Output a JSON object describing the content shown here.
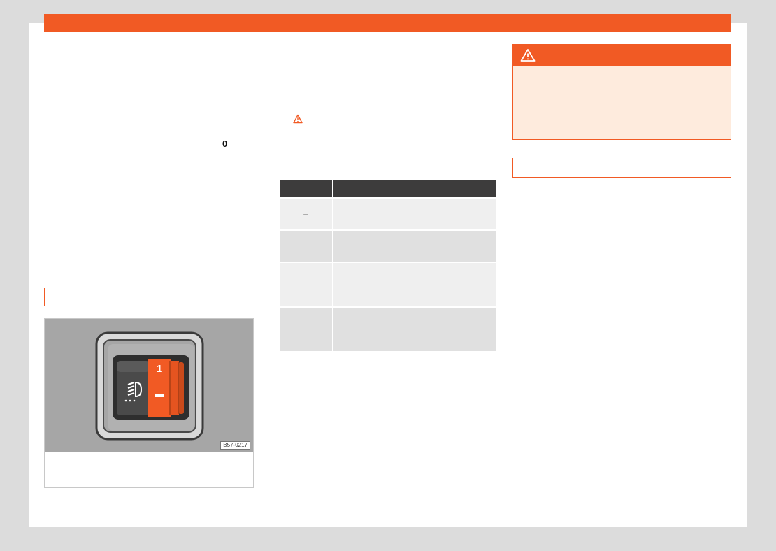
{
  "left_column": {
    "glyph": "0",
    "figure": {
      "code": "B57-0217",
      "roller_marks": [
        "1",
        "–"
      ],
      "icon": "headlight-range-icon"
    }
  },
  "middle_column": {
    "warning_icon": "warning-triangle-icon",
    "table": {
      "rows": [
        {
          "col1": "–",
          "col2": ""
        },
        {
          "col1": "",
          "col2": ""
        },
        {
          "col1": "",
          "col2": ""
        },
        {
          "col1": "",
          "col2": ""
        }
      ]
    }
  },
  "right_column": {
    "warning_box": {
      "icon": "warning-triangle-icon"
    }
  },
  "colors": {
    "accent": "#f15a24",
    "warning_background": "#feebdd",
    "table_header": "#3d3c3c",
    "row_light": "#efefef",
    "row_dark": "#e0e0e0",
    "figure_background": "#a6a6a6"
  }
}
